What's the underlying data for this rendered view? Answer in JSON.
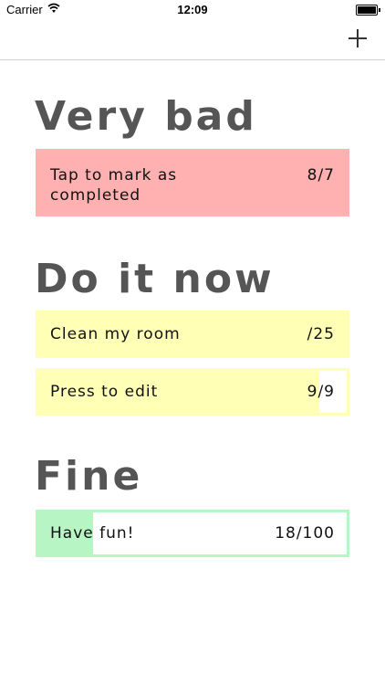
{
  "status_bar": {
    "carrier": "Carrier",
    "time": "12:09"
  },
  "nav": {
    "add_icon": "plus-icon"
  },
  "sections": [
    {
      "title": "Very bad",
      "tasks": [
        {
          "label": "Tap to mark as completed",
          "count": "8/7",
          "color": "#ffb0b0"
        }
      ]
    },
    {
      "title": "Do it now",
      "tasks": [
        {
          "label": "Clean my room",
          "count": "/25",
          "color": "#ffffb5"
        },
        {
          "label": "Press to edit",
          "count": "9/9",
          "color": "#ffffb5"
        }
      ]
    },
    {
      "title": "Fine",
      "tasks": [
        {
          "label": "Have fun!",
          "count": "18/100",
          "progress": 0.18,
          "color": "#b8f5c4"
        }
      ]
    }
  ]
}
